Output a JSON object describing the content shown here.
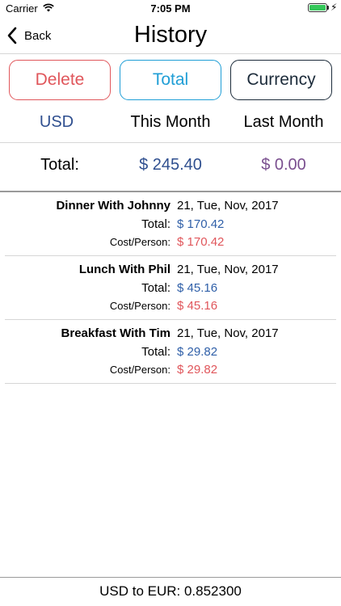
{
  "status_bar": {
    "carrier": "Carrier",
    "time": "7:05 PM",
    "battery_icon": "battery-icon",
    "wifi_icon": "wifi-icon",
    "charging_icon": "bolt-icon"
  },
  "nav": {
    "back_label": "Back",
    "title": "History"
  },
  "buttons": {
    "delete": "Delete",
    "total": "Total",
    "currency": "Currency"
  },
  "columns": {
    "currency": "USD",
    "this_month": "This Month",
    "last_month": "Last Month"
  },
  "totals": {
    "label": "Total:",
    "this_month": "$ 245.40",
    "last_month": "$ 0.00"
  },
  "history": [
    {
      "name": "Dinner With Johnny",
      "date": "21, Tue, Nov, 2017",
      "total_label": "Total:",
      "total": "$ 170.42",
      "cpp_label": "Cost/Person:",
      "cpp": "$ 170.42"
    },
    {
      "name": "Lunch With Phil",
      "date": "21, Tue, Nov, 2017",
      "total_label": "Total:",
      "total": "$ 45.16",
      "cpp_label": "Cost/Person:",
      "cpp": "$ 45.16"
    },
    {
      "name": "Breakfast With Tim",
      "date": "21, Tue, Nov, 2017",
      "total_label": "Total:",
      "total": "$ 29.82",
      "cpp_label": "Cost/Person:",
      "cpp": "$ 29.82"
    }
  ],
  "footer": {
    "rate": "USD to EUR:  0.852300"
  },
  "colors": {
    "delete": "#e0565b",
    "total": "#1f9ed6",
    "currency": "#1c2b3a",
    "amount_blue": "#2f4f8f",
    "amount_purple": "#7a4f8f",
    "cost_red": "#e0565b"
  }
}
